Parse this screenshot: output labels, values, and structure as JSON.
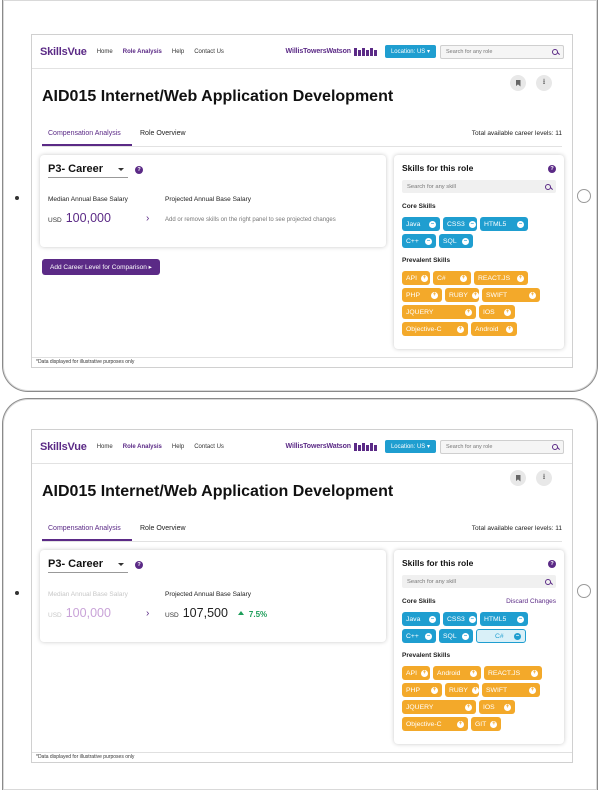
{
  "colors": {
    "brand": "#5b2a86",
    "accent_blue": "#1f9ed0",
    "skill_orange": "#f3a92a",
    "positive": "#1d9e5a"
  },
  "header": {
    "logo": "SkillsVue",
    "nav": [
      "Home",
      "Role Analysis",
      "Help",
      "Contact Us"
    ],
    "partner": "WillisTowersWatson",
    "location_button": "Location: US",
    "search_placeholder": "Search for any role"
  },
  "role": {
    "title": "AID015 Internet/Web Application Development"
  },
  "tabs": {
    "compensation": "Compensation Analysis",
    "overview": "Role Overview",
    "levels": "Total available career levels: 11"
  },
  "career": {
    "level": "P3- Career",
    "median_label": "Median Annual Base Salary",
    "projected_label": "Projected Annual Base Salary",
    "currency": "USD",
    "median_value": "100,000",
    "hint": "Add or remove skills on the right panel to see projected changes",
    "add_button": "Add Career Level for Comparison"
  },
  "skills_panel": {
    "title": "Skills for this role",
    "search_placeholder": "Search for any skill",
    "core_title": "Core Skills",
    "prevalent_title": "Prevalent Skills",
    "discard": "Discard Changes"
  },
  "screen1": {
    "core": [
      "Java",
      "CSS3",
      "HTML5",
      "C++",
      "SQL"
    ],
    "prevalent": [
      "API",
      "C#",
      "REACT.JS",
      "PHP",
      "RUBY",
      "SWIFT",
      "JQUERY",
      "IOS",
      "Objective-C",
      "Android"
    ]
  },
  "screen2": {
    "projected_value": "107,500",
    "projected_change": "7.5%",
    "core": [
      "Java",
      "CSS3",
      "HTML5",
      "C++",
      "SQL"
    ],
    "core_added": "C#",
    "prevalent": [
      "API",
      "Android",
      "REACT.JS",
      "PHP",
      "RUBY",
      "SWIFT",
      "JQUERY",
      "IOS",
      "Objective-C",
      "GIT"
    ]
  },
  "footnote": "*Data displayed for illustrative purposes only",
  "icons": {
    "remove": "minus-circle-icon",
    "add": "plus-circle-icon",
    "bookmark": "bookmark-icon",
    "download": "download-icon",
    "help": "help-icon",
    "search": "search-icon"
  }
}
